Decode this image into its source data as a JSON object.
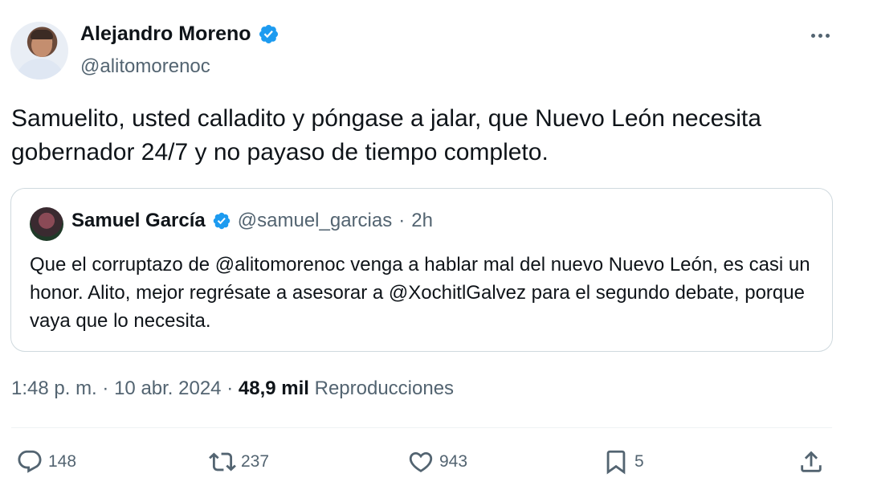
{
  "author": {
    "name": "Alejandro Moreno",
    "handle": "@alitomorenoc",
    "verified": true
  },
  "tweet": {
    "text": "Samuelito, usted calladito y póngase a jalar, que Nuevo León necesita gobernador 24/7 y no payaso de tiempo completo."
  },
  "quoted": {
    "name": "Samuel García",
    "handle": "@samuel_garcias",
    "separator": "·",
    "time": "2h",
    "text": "Que el corruptazo de @alitomorenoc venga a hablar mal del nuevo Nuevo León, es casi un honor. Alito, mejor regrésate a asesorar a @XochitlGalvez para el segundo debate, porque vaya que lo necesita."
  },
  "meta": {
    "time": "1:48 p. m.",
    "dot": "·",
    "date": "10 abr. 2024",
    "views_count": "48,9 mil",
    "views_label": "Reproducciones"
  },
  "actions": {
    "replies": "148",
    "reposts": "237",
    "likes": "943",
    "bookmarks": "5"
  },
  "colors": {
    "verified_blue": "#1d9bf0",
    "text_secondary": "#536471",
    "text_primary": "#0f1419"
  }
}
